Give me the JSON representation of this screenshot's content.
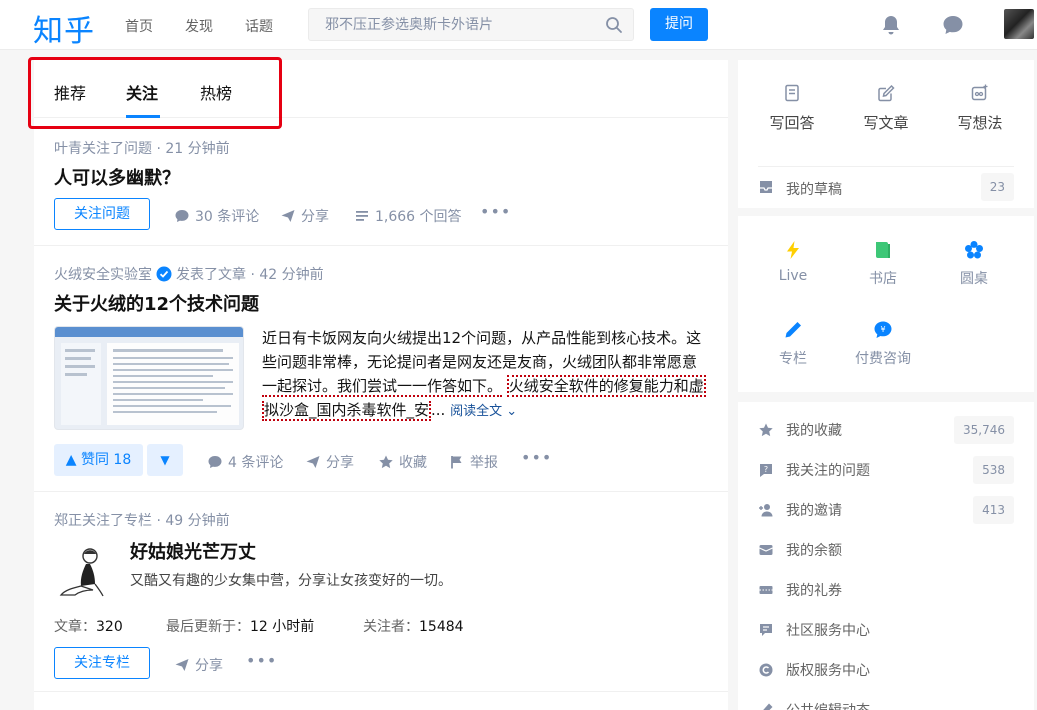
{
  "header": {
    "logo": "知乎",
    "nav": [
      "首页",
      "发现",
      "话题"
    ],
    "search_placeholder": "邪不压正参选奥斯卡外语片",
    "ask_label": "提问"
  },
  "tabs": [
    "推荐",
    "关注",
    "热榜"
  ],
  "feed": [
    {
      "meta": "叶青关注了问题 · 21 分钟前",
      "title": "人可以多幽默？",
      "follow_label": "关注问题",
      "comments": "30 条评论",
      "share": "分享",
      "answers": "1,666 个回答"
    },
    {
      "author": "火绒安全实验室",
      "meta_suffix": "发表了文章 · 42 分钟前",
      "title": "关于火绒的12个技术问题",
      "excerpt_1": "近日有卡饭网友向火绒提出12个问题，从产品性能到核心技术。这些问题非常棒，无论提问者是网友还是友商，火绒团队都非常愿意",
      "excerpt_2": "一起探讨。我们尝试一一作答如下。",
      "excerpt_3": "火绒安全软件的修复能力和虚",
      "excerpt_4": "拟沙盒_国内杀毒软件_安",
      "excerpt_5": "...",
      "read_all": "阅读全文",
      "vote": "▲ 赞同 18",
      "vote_down": "▼",
      "comments": "4 条评论",
      "share": "分享",
      "collect": "收藏",
      "report": "举报"
    },
    {
      "meta": "郑正关注了专栏 · 49 分钟前",
      "title": "好姑娘光芒万丈",
      "desc": "又酷又有趣的少女集中营，分享让女孩变好的一切。",
      "stats": [
        {
          "label": "文章：",
          "value": "320"
        },
        {
          "label": "最后更新于：",
          "value": "12 小时前"
        },
        {
          "label": "关注者：",
          "value": "15484"
        }
      ],
      "follow_label": "关注专栏",
      "share": "分享"
    }
  ],
  "sidebar": {
    "write": [
      "写回答",
      "写文章",
      "写想法"
    ],
    "draft": {
      "label": "我的草稿",
      "count": "23"
    },
    "grid": [
      "Live",
      "书店",
      "圆桌",
      "专栏",
      "付费咨询"
    ],
    "menu": [
      {
        "label": "我的收藏",
        "count": "35,746"
      },
      {
        "label": "我关注的问题",
        "count": "538"
      },
      {
        "label": "我的邀请",
        "count": "413"
      },
      {
        "label": "我的余额",
        "count": ""
      },
      {
        "label": "我的礼券",
        "count": ""
      },
      {
        "label": "社区服务中心",
        "count": ""
      },
      {
        "label": "版权服务中心",
        "count": ""
      },
      {
        "label": "公共编辑动态",
        "count": ""
      }
    ]
  },
  "colors": {
    "brand": "#0a84ff",
    "highlight": "#e60012"
  }
}
